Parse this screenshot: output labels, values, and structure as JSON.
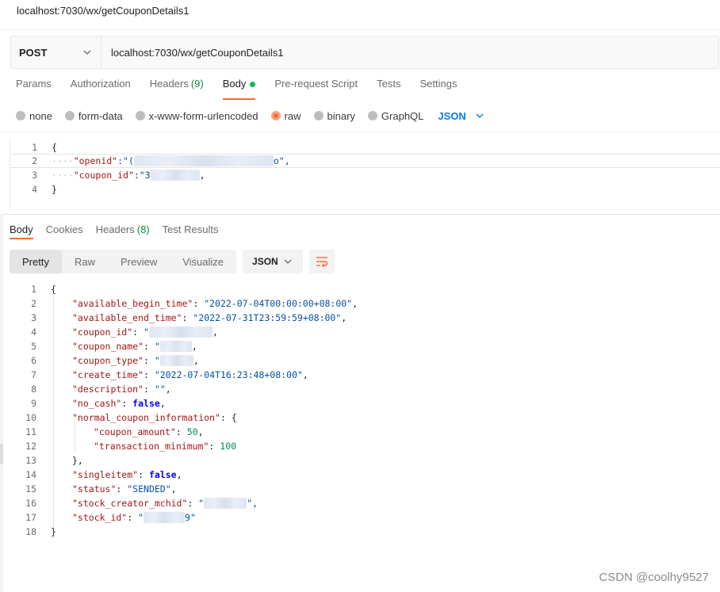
{
  "window": {
    "title": "localhost:7030/wx/getCouponDetails1"
  },
  "request": {
    "method": "POST",
    "url": "localhost:7030/wx/getCouponDetails1"
  },
  "request_tabs": [
    {
      "label": "Params"
    },
    {
      "label": "Authorization"
    },
    {
      "label": "Headers",
      "count": "(9)"
    },
    {
      "label": "Body"
    },
    {
      "label": "Pre-request Script"
    },
    {
      "label": "Tests"
    },
    {
      "label": "Settings"
    }
  ],
  "body_types": [
    "none",
    "form-data",
    "x-www-form-urlencoded",
    "raw",
    "binary",
    "GraphQL"
  ],
  "body_format": "JSON",
  "request_body": {
    "line_numbers": [
      "1",
      "2",
      "3",
      "4"
    ],
    "open": "{",
    "close": "}",
    "dots": "····",
    "openid_key": "\"openid\"",
    "openid_pre": ":\"(",
    "openid_post": "o\",",
    "coupon_id_key": "\"coupon_id\"",
    "coupon_id_pre": ":\"3",
    "coupon_id_post": ","
  },
  "response_tabs": [
    {
      "label": "Body"
    },
    {
      "label": "Cookies"
    },
    {
      "label": "Headers",
      "count": "(8)"
    },
    {
      "label": "Test Results"
    }
  ],
  "view_modes": [
    "Pretty",
    "Raw",
    "Preview",
    "Visualize"
  ],
  "response_format": "JSON",
  "response_body": {
    "line_numbers": [
      "1",
      "2",
      "3",
      "4",
      "5",
      "6",
      "7",
      "8",
      "9",
      "10",
      "11",
      "12",
      "13",
      "14",
      "15",
      "16",
      "17",
      "18"
    ],
    "open": "{",
    "close": "}",
    "available_begin_time_key": "\"available_begin_time\"",
    "available_begin_time": "\"2022-07-04T00:00:00+08:00\"",
    "available_end_time_key": "\"available_end_time\"",
    "available_end_time": "\"2022-07-31T23:59:59+08:00\"",
    "coupon_id_key": "\"coupon_id\"",
    "coupon_id_pre": "\"",
    "coupon_name_key": "\"coupon_name\"",
    "coupon_name_pre": "\"",
    "coupon_type_key": "\"coupon_type\"",
    "coupon_type_pre": "\"",
    "create_time_key": "\"create_time\"",
    "create_time": "\"2022-07-04T16:23:48+08:00\"",
    "description_key": "\"description\"",
    "description": "\"\"",
    "no_cash_key": "\"no_cash\"",
    "no_cash": "false",
    "normal_coupon_information_key": "\"normal_coupon_information\"",
    "coupon_amount_key": "\"coupon_amount\"",
    "coupon_amount": "50",
    "transaction_minimum_key": "\"transaction_minimum\"",
    "transaction_minimum": "100",
    "singleitem_key": "\"singleitem\"",
    "singleitem": "false",
    "status_key": "\"status\"",
    "status": "\"SENDED\"",
    "stock_creator_mchid_key": "\"stock_creator_mchid\"",
    "stock_creator_mchid_pre": "\"",
    "stock_creator_mchid_post": "\",",
    "stock_id_key": "\"stock_id\"",
    "stock_id_pre": "\"",
    "stock_id_post": "9\""
  },
  "watermark": "CSDN @coolhy9527",
  "colors": {
    "accent": "#f26b3a",
    "link": "#097bed",
    "json_key": "#a31515",
    "json_string": "#0451a5"
  }
}
